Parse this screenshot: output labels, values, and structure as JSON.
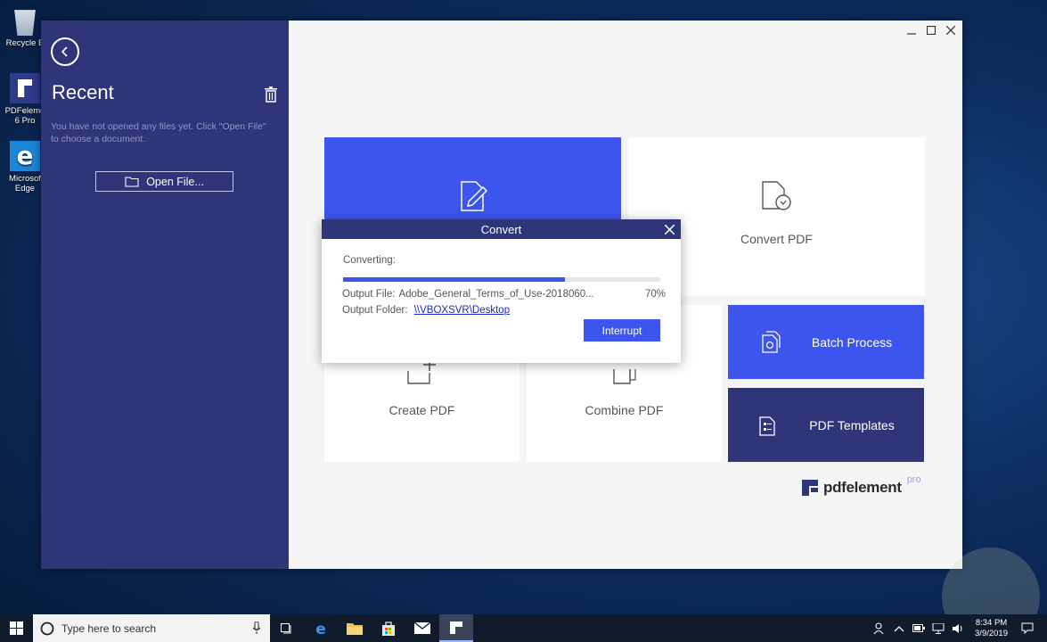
{
  "desktop": {
    "icons": [
      {
        "label": "Recycle B",
        "icon": "recycle-bin-icon"
      },
      {
        "label": "PDFeleme\n6 Pro",
        "icon": "pdfelement-icon"
      },
      {
        "label": "Microsof\nEdge",
        "icon": "edge-icon"
      }
    ]
  },
  "sidebar": {
    "title": "Recent",
    "hint": "You have not opened any files yet. Click \"Open File\" to choose a document.",
    "open_file_label": "Open File..."
  },
  "tiles": {
    "convert_pdf": "Convert PDF",
    "create_pdf": "Create PDF",
    "combine_pdf": "Combine PDF",
    "batch_process": "Batch Process",
    "pdf_templates": "PDF Templates"
  },
  "brand": {
    "name": "pdfelement",
    "suffix": "pro"
  },
  "dialog": {
    "title": "Convert",
    "converting_label": "Converting:",
    "output_file_label": "Output File:",
    "output_file_value": "Adobe_General_Terms_of_Use-2018060...",
    "progress_percent_label": "70%",
    "progress_fraction": 0.7,
    "output_folder_label": "Output Folder:",
    "output_folder_value": "\\\\VBOXSVR\\Desktop",
    "interrupt_label": "Interrupt"
  },
  "taskbar": {
    "search_placeholder": "Type here to search",
    "clock_time": "8:34 PM",
    "clock_date": "3/9/2019"
  },
  "colors": {
    "sidebar": "#2e3679",
    "accent": "#3c55ef",
    "dialog_header": "#2e3679",
    "taskbar": "#101c2c"
  }
}
